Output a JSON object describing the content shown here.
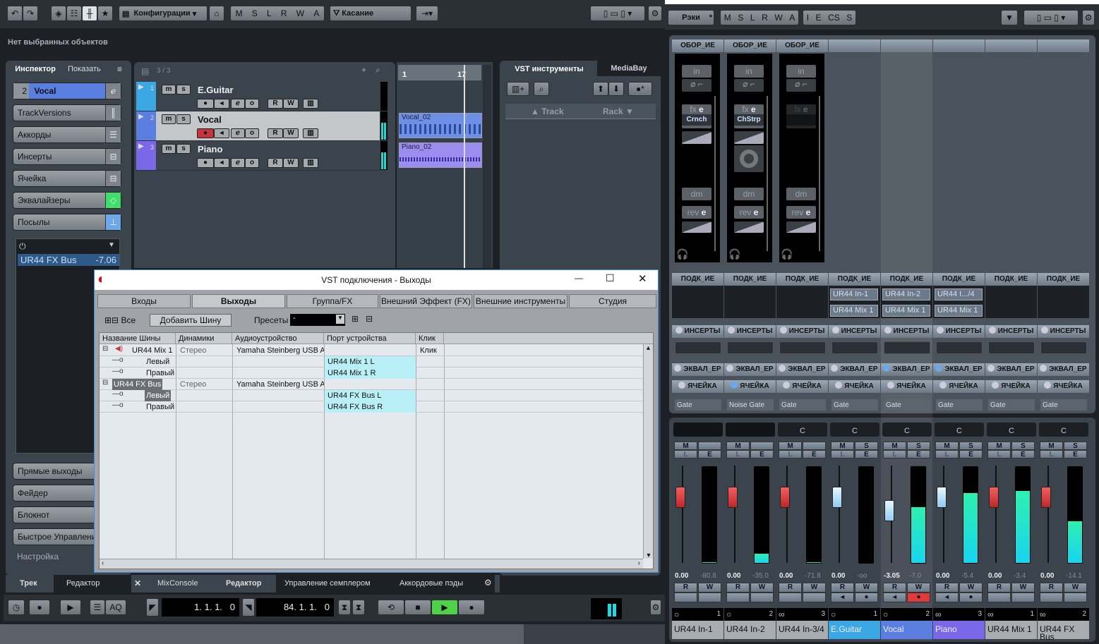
{
  "project": {
    "toolbar": {
      "config_label": "Конфигурации",
      "auto_modes": [
        "M",
        "S",
        "L",
        "R",
        "W",
        "A"
      ],
      "touch_label": "Касание"
    },
    "info_line": "Нет выбранных объектов",
    "left_tabs": {
      "inspector": "Инспектор",
      "show": "Показать"
    },
    "inspector": {
      "track_num": "2",
      "track_name": "Vocal",
      "sections": [
        "TrackVersions",
        "Аккорды",
        "Инсерты",
        "Ячейка",
        "Эквалайзеры",
        "Посылы"
      ],
      "send_dest": "UR44 FX Bus",
      "send_level": "-7.06",
      "lower_sections": [
        "Прямые выходы",
        "Фейдер",
        "Блокнот",
        "Быстрое Управлени"
      ],
      "setup_label": "Настройка"
    },
    "tracklist": {
      "count": "3 / 3",
      "tracks": [
        {
          "num": "1",
          "name": "E.Guitar",
          "color": "#3ba7e5"
        },
        {
          "num": "2",
          "name": "Vocal",
          "color": "#5a7fe0",
          "record": true
        },
        {
          "num": "3",
          "name": "Piano",
          "color": "#7b68e8"
        }
      ]
    },
    "ruler": {
      "bar_start": "1",
      "bar_end": "17"
    },
    "events": [
      {
        "name": "Vocal_02"
      },
      {
        "name": "Piano_02"
      }
    ],
    "right_zone": {
      "tabs": [
        "VST инструменты",
        "MediaBay"
      ],
      "col_track": "Track",
      "col_rack": "Rack"
    },
    "bottom_tabs": [
      "Трек",
      "Редактор",
      "MixConsole",
      "Редактор",
      "Управление семплером",
      "Аккордовые пэды"
    ],
    "transport": {
      "left_locator": "1. 1. 1.   0",
      "right_locator": "84. 1. 1.   0",
      "aq": "AQ"
    }
  },
  "dialog": {
    "title": "VST подключения - Выходы",
    "tabs": [
      "Входы",
      "Выходы",
      "Группа/FX",
      "Внешний Эффект (FX)",
      "Внешние инструменты",
      "Студия"
    ],
    "active_tab": "Выходы",
    "all_label": "Все",
    "add_bus": "Добавить Шину",
    "presets_label": "Пресеты",
    "preset_value": "-",
    "columns": [
      "Название Шины",
      "Динамики",
      "Аудиоустройство",
      "Порт устройства",
      "Клик"
    ],
    "rows": [
      {
        "name": "UR44 Mix 1",
        "speakers": "Стерео",
        "device": "Yamaha Steinberg USB A",
        "port": "",
        "click": "Клик",
        "level": 0
      },
      {
        "name": "Левый",
        "speakers": "",
        "device": "",
        "port": "UR44 Mix 1 L",
        "click": "",
        "level": 1
      },
      {
        "name": "Правый",
        "speakers": "",
        "device": "",
        "port": "UR44 Mix 1 R",
        "click": "",
        "level": 1
      },
      {
        "name": "UR44 FX Bus",
        "speakers": "Стерео",
        "device": "Yamaha Steinberg USB A",
        "port": "",
        "click": "",
        "level": 0,
        "selected": true
      },
      {
        "name": "Левый",
        "speakers": "",
        "device": "",
        "port": "UR44 FX Bus L",
        "click": "",
        "level": 1,
        "selected": true
      },
      {
        "name": "Правый",
        "speakers": "",
        "device": "",
        "port": "UR44 FX Bus R",
        "click": "",
        "level": 1
      }
    ]
  },
  "mixer": {
    "toolbar": {
      "racks": "Рэки",
      "modes1": [
        "M",
        "S",
        "L",
        "R",
        "W",
        "A"
      ],
      "modes2": [
        "I",
        "E",
        "CS",
        "S"
      ]
    },
    "labels": {
      "rack": "ОБОР_ИЕ",
      "routing": "ПОДК_ИЕ",
      "inserts": "ИНСЕРТЫ",
      "eq": "ЭКВАЛ_ЕР",
      "strip": "ЯЧЕЙКА",
      "in": "in",
      "fx": "fx",
      "dm": "dm",
      "rev": "rev",
      "edit": "e",
      "read": "R",
      "write": "W",
      "mute": "M",
      "solo": "S",
      "listen": "L",
      "editch": "E"
    },
    "channels": [
      {
        "name": "UR44 In-1",
        "num": "1",
        "stereo": false,
        "color": "#a9adb1",
        "volume": "0.00",
        "peak": "-80.8",
        "fader": 0.8,
        "meter": 0.01,
        "fader_color": "red",
        "pan": "",
        "solo": false,
        "rack": true,
        "fx": "Crnch",
        "in_out": [
          "",
          ""
        ],
        "eq": false,
        "strip": false,
        "strip_fx": "Gate",
        "rec": false
      },
      {
        "name": "UR44 In-2",
        "num": "2",
        "stereo": false,
        "color": "#a9adb1",
        "volume": "0.00",
        "peak": "-35.0",
        "fader": 0.8,
        "meter": 0.1,
        "fader_color": "red",
        "pan": "",
        "solo": false,
        "rack": true,
        "fx": "ChStrp",
        "in_out": [
          "",
          ""
        ],
        "eq": false,
        "strip": true,
        "strip_fx": "Noise Gate",
        "rec": false
      },
      {
        "name": "UR44 In-3/4",
        "num": "3",
        "stereo": true,
        "color": "#a9adb1",
        "volume": "0.00",
        "peak": "-71.8",
        "fader": 0.8,
        "meter": 0.01,
        "fader_color": "red",
        "pan": "C",
        "solo": false,
        "rack": true,
        "fx": "",
        "in_out": [
          "",
          ""
        ],
        "eq": false,
        "strip": false,
        "strip_fx": "Gate",
        "rec": false
      },
      {
        "name": "E.Guitar",
        "num": "1",
        "stereo": false,
        "color": "#3ba7e5",
        "volume": "0.00",
        "peak": "-oo",
        "fader": 0.8,
        "meter": 0,
        "fader_color": "blue",
        "pan": "C",
        "solo": true,
        "rack": false,
        "fx": "",
        "in_out": [
          "UR44 In-1",
          "UR44 Mix 1"
        ],
        "eq": false,
        "strip": false,
        "strip_fx": "Gate",
        "rec": false,
        "monitor": true
      },
      {
        "name": "Vocal",
        "num": "2",
        "stereo": false,
        "color": "#5a7fe0",
        "volume": "-3.05",
        "peak": "-7.0",
        "fader": 0.68,
        "meter": 0.62,
        "fader_color": "blue",
        "pan": "C",
        "solo": true,
        "rack": false,
        "fx": "",
        "in_out": [
          "UR44 In-2",
          "UR44 Mix 1"
        ],
        "eq": true,
        "strip": false,
        "strip_fx": "Gate",
        "rec": true,
        "monitor": true,
        "selected": true
      },
      {
        "name": "Piano",
        "num": "3",
        "stereo": true,
        "color": "#7b68e8",
        "volume": "0.00",
        "peak": "-5.4",
        "fader": 0.8,
        "meter": 0.77,
        "fader_color": "blue",
        "pan": "C",
        "solo": true,
        "rack": false,
        "fx": "",
        "in_out": [
          "UR44 I.../4",
          "UR44 Mix 1"
        ],
        "eq": true,
        "strip": false,
        "strip_fx": "Gate",
        "rec": false,
        "monitor": true
      },
      {
        "name": "UR44 Mix 1",
        "num": "1",
        "stereo": true,
        "color": "#a9adb1",
        "volume": "0.00",
        "peak": "-3.4",
        "fader": 0.8,
        "meter": 0.8,
        "fader_color": "red",
        "pan": "C",
        "solo": true,
        "rack": false,
        "fx": "",
        "in_out": [
          "",
          ""
        ],
        "eq": false,
        "strip": false,
        "strip_fx": "Gate",
        "rec": false
      },
      {
        "name": "UR44 FX Bus",
        "num": "2",
        "stereo": true,
        "color": "#a9adb1",
        "volume": "0.00",
        "peak": "-14.1",
        "fader": 0.8,
        "meter": 0.46,
        "fader_color": "red",
        "pan": "C",
        "solo": true,
        "rack": false,
        "fx": "",
        "in_out": [
          "",
          ""
        ],
        "eq": false,
        "strip": false,
        "strip_fx": "Gate",
        "rec": false
      }
    ]
  }
}
